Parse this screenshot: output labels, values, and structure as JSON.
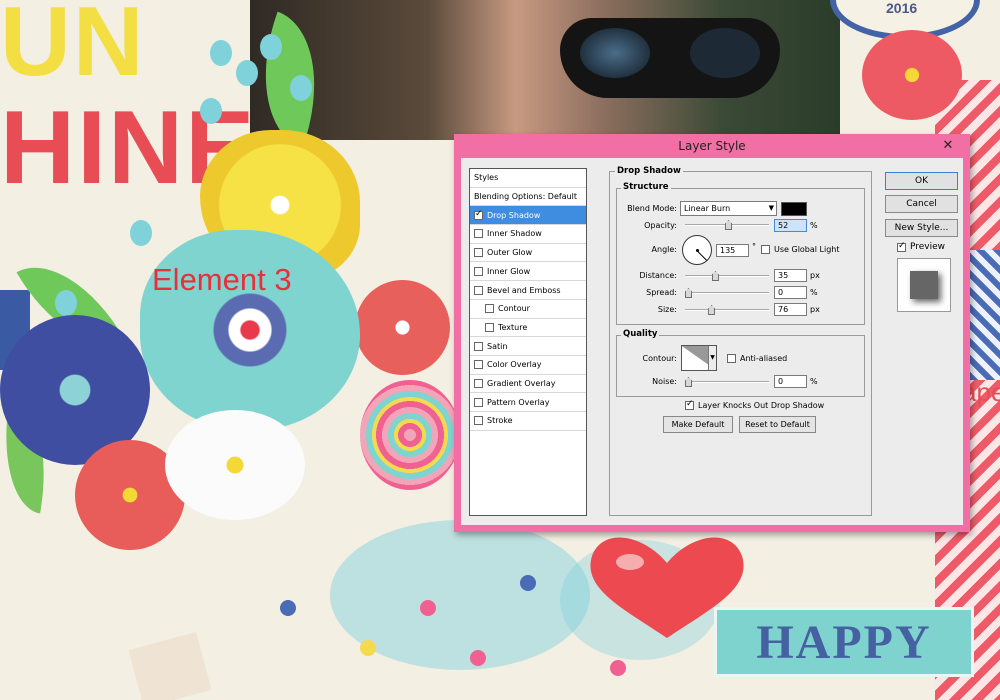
{
  "background": {
    "word_un": "UN",
    "word_hine": "HINE",
    "element_label": "Element 3",
    "badge_year": "2016",
    "happy_label": "HAPPY",
    "side_text": "ape"
  },
  "dialog": {
    "title": "Layer Style",
    "close_glyph": "✕",
    "styles_panel": {
      "header": "Styles",
      "blending_options": "Blending Options: Default",
      "items": [
        {
          "label": "Drop Shadow",
          "checked": true,
          "selected": true,
          "indent": false
        },
        {
          "label": "Inner Shadow",
          "checked": false,
          "selected": false,
          "indent": false
        },
        {
          "label": "Outer Glow",
          "checked": false,
          "selected": false,
          "indent": false
        },
        {
          "label": "Inner Glow",
          "checked": false,
          "selected": false,
          "indent": false
        },
        {
          "label": "Bevel and Emboss",
          "checked": false,
          "selected": false,
          "indent": false
        },
        {
          "label": "Contour",
          "checked": false,
          "selected": false,
          "indent": true
        },
        {
          "label": "Texture",
          "checked": false,
          "selected": false,
          "indent": true
        },
        {
          "label": "Satin",
          "checked": false,
          "selected": false,
          "indent": false
        },
        {
          "label": "Color Overlay",
          "checked": false,
          "selected": false,
          "indent": false
        },
        {
          "label": "Gradient Overlay",
          "checked": false,
          "selected": false,
          "indent": false
        },
        {
          "label": "Pattern Overlay",
          "checked": false,
          "selected": false,
          "indent": false
        },
        {
          "label": "Stroke",
          "checked": false,
          "selected": false,
          "indent": false
        }
      ]
    },
    "drop_shadow": {
      "title": "Drop Shadow",
      "structure": {
        "title": "Structure",
        "blend_mode_label": "Blend Mode:",
        "blend_mode_value": "Linear Burn",
        "shadow_color": "#000000",
        "opacity_label": "Opacity:",
        "opacity_value": "52",
        "opacity_slider_percent": 52,
        "opacity_unit": "%",
        "angle_label": "Angle:",
        "angle_value": "135",
        "angle_unit": "°",
        "use_global_light_label": "Use Global Light",
        "use_global_light": false,
        "distance_label": "Distance:",
        "distance_value": "35",
        "distance_slider_percent": 35,
        "distance_unit": "px",
        "spread_label": "Spread:",
        "spread_value": "0",
        "spread_slider_percent": 0,
        "spread_unit": "%",
        "size_label": "Size:",
        "size_value": "76",
        "size_slider_percent": 30,
        "size_unit": "px"
      },
      "quality": {
        "title": "Quality",
        "contour_label": "Contour:",
        "anti_aliased_label": "Anti-aliased",
        "anti_aliased": false,
        "noise_label": "Noise:",
        "noise_value": "0",
        "noise_slider_percent": 0,
        "noise_unit": "%"
      },
      "knockout_label": "Layer Knocks Out Drop Shadow",
      "knockout": true,
      "make_default_label": "Make Default",
      "reset_default_label": "Reset to Default"
    },
    "buttons": {
      "ok": "OK",
      "cancel": "Cancel",
      "new_style": "New Style...",
      "preview_label": "Preview",
      "preview_checked": true
    }
  }
}
